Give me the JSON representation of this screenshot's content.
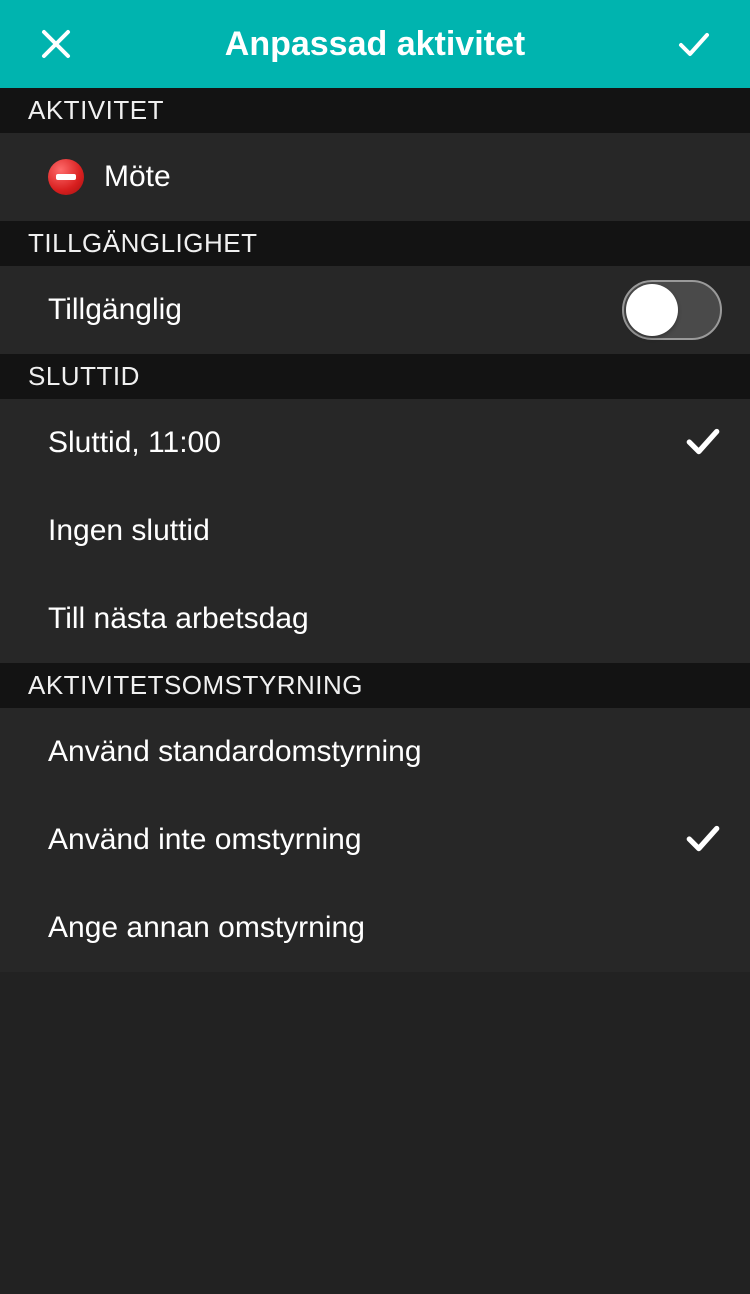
{
  "header": {
    "title": "Anpassad aktivitet"
  },
  "sections": {
    "activity": {
      "header": "AKTIVITET",
      "item_label": "Möte"
    },
    "availability": {
      "header": "TILLGÄNGLIGHET",
      "item_label": "Tillgänglig",
      "toggle_on": false
    },
    "endtime": {
      "header": "SLUTTID",
      "options": [
        {
          "label": "Sluttid,  11:00",
          "selected": true
        },
        {
          "label": "Ingen sluttid",
          "selected": false
        },
        {
          "label": "Till nästa arbetsdag",
          "selected": false
        }
      ]
    },
    "diversion": {
      "header": "AKTIVITETSOMSTYRNING",
      "options": [
        {
          "label": "Använd standardomstyrning",
          "selected": false
        },
        {
          "label": "Använd inte omstyrning",
          "selected": true
        },
        {
          "label": "Ange annan omstyrning",
          "selected": false
        }
      ]
    }
  }
}
